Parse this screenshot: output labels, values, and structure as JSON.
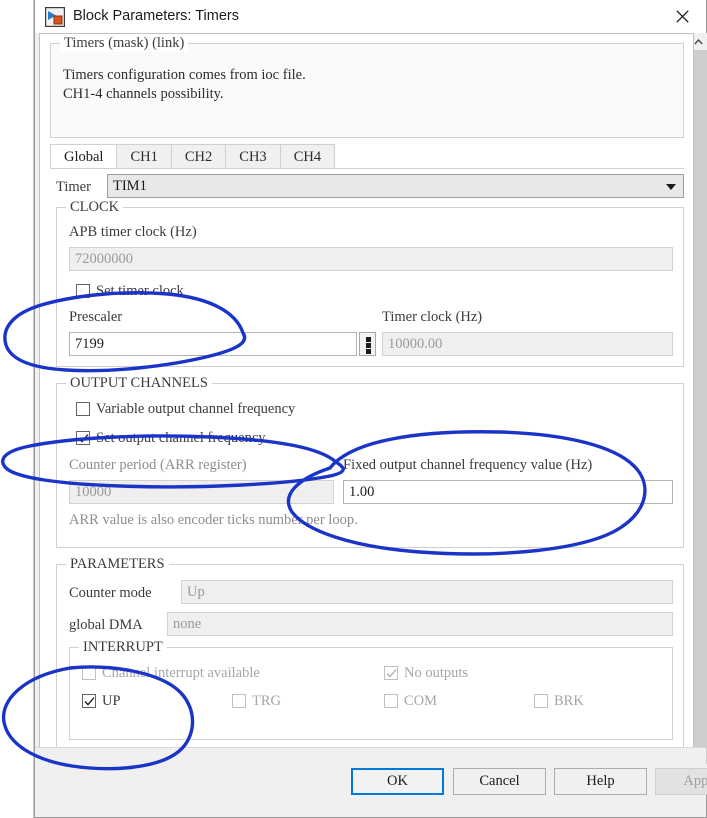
{
  "window": {
    "title": "Block Parameters: Timers",
    "icon": "simulink-block-icon",
    "close_label": "close-icon"
  },
  "mask": {
    "legend": "Timers (mask) (link)",
    "description": "Timers configuration comes from ioc file.\nCH1-4 channels possibility."
  },
  "tabs": [
    {
      "label": "Global",
      "active": true
    },
    {
      "label": "CH1",
      "active": false
    },
    {
      "label": "CH2",
      "active": false
    },
    {
      "label": "CH3",
      "active": false
    },
    {
      "label": "CH4",
      "active": false
    }
  ],
  "timer": {
    "label": "Timer",
    "value": "TIM1"
  },
  "clock": {
    "legend": "CLOCK",
    "apb_label": "APB timer clock (Hz)",
    "apb_value": "72000000",
    "set_timer_clock_label": "Set timer clock",
    "set_timer_clock_checked": false,
    "prescaler_label": "Prescaler",
    "prescaler_value": "7199",
    "timer_clock_label": "Timer clock (Hz)",
    "timer_clock_value": "10000.00"
  },
  "output_channels": {
    "legend": "OUTPUT CHANNELS",
    "variable_freq_label": "Variable output channel frequency",
    "variable_freq_checked": false,
    "set_freq_label": "Set output channel frequency",
    "set_freq_checked": true,
    "counter_period_label": "Counter period (ARR register)",
    "counter_period_value": "10000",
    "fixed_freq_label": "Fixed output channel frequency value (Hz)",
    "fixed_freq_value": "1.00",
    "arr_note": "ARR value is also encoder ticks number per loop."
  },
  "parameters": {
    "legend": "PARAMETERS",
    "counter_mode_label": "Counter mode",
    "counter_mode_value": "Up",
    "global_dma_label": "global DMA",
    "global_dma_value": "none"
  },
  "interrupt": {
    "legend": "INTERRUPT",
    "channel_interrupt_label": "Channel interrupt available",
    "channel_interrupt_checked": false,
    "no_outputs_label": "No outputs",
    "no_outputs_checked": true,
    "up_label": "UP",
    "up_checked": true,
    "trg_label": "TRG",
    "trg_checked": false,
    "com_label": "COM",
    "com_checked": false,
    "brk_label": "BRK",
    "brk_checked": false
  },
  "buttons": {
    "ok": "OK",
    "cancel": "Cancel",
    "help": "Help",
    "apply": "Apply"
  },
  "annotation": {
    "color": "#1a34c8",
    "description": "hand-drawn blue ink circles highlighting Prescaler, Set output channel frequency / Fixed output channel frequency value, and the INTERRUPT UP checkbox"
  },
  "colors": {
    "accent": "#0078d7",
    "window_bg": "#f0f0f0",
    "panel_bg": "#ffffff",
    "ink": "#1a34c8",
    "disabled_text": "#a0a0a0"
  }
}
